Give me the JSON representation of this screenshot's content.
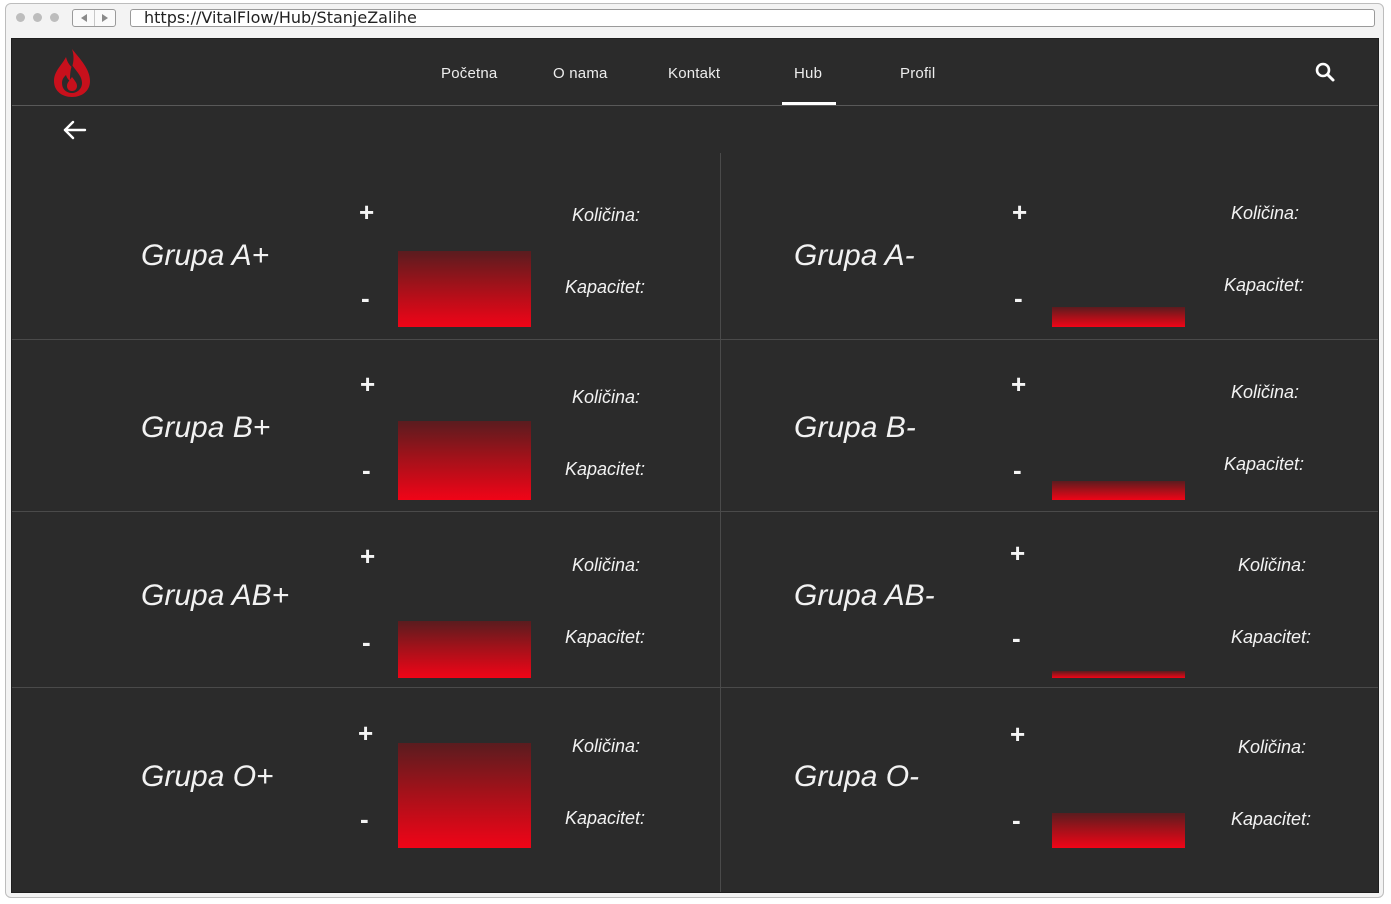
{
  "browser": {
    "url": "https://VitalFlow/Hub/StanjeZalihe"
  },
  "nav": {
    "items": [
      {
        "label": "Početna"
      },
      {
        "label": "O nama"
      },
      {
        "label": "Kontakt"
      },
      {
        "label": "Hub"
      },
      {
        "label": "Profil"
      }
    ],
    "active": "Hub",
    "accent_color": "#e30613"
  },
  "labels": {
    "plus": "+",
    "minus": "-",
    "kolicina": "Količina:",
    "kapacitet": "Kapacitet:"
  },
  "groups": [
    {
      "name": "Grupa A+",
      "fill": 0.58
    },
    {
      "name": "Grupa A-",
      "fill": 0.15
    },
    {
      "name": "Grupa B+",
      "fill": 0.6
    },
    {
      "name": "Grupa B-",
      "fill": 0.14
    },
    {
      "name": "Grupa AB+",
      "fill": 0.42
    },
    {
      "name": "Grupa AB-",
      "fill": 0.05
    },
    {
      "name": "Grupa O+",
      "fill": 0.78
    },
    {
      "name": "Grupa O-",
      "fill": 0.26
    }
  ]
}
